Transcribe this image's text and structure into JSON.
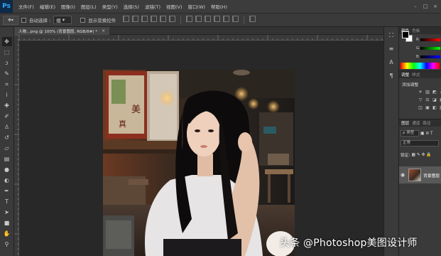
{
  "app": {
    "logo": "Ps"
  },
  "menu": [
    "文件(F)",
    "编辑(E)",
    "图像(I)",
    "图层(L)",
    "类型(Y)",
    "选择(S)",
    "滤镜(T)",
    "视图(V)",
    "窗口(W)",
    "帮助(H)"
  ],
  "options": {
    "auto_select_label": "自动选择 :",
    "auto_select_value": "组",
    "show_transform_label": "显示变换控件"
  },
  "document": {
    "tab_title": "人物...png @ 100% (背景图层, RGB/8#) *",
    "close_glyph": "×"
  },
  "tools": [
    {
      "name": "move-tool-icon",
      "glyph": "✥"
    },
    {
      "name": "marquee-tool-icon",
      "glyph": "⬚"
    },
    {
      "name": "lasso-tool-icon",
      "glyph": "ↄ"
    },
    {
      "name": "quick-select-tool-icon",
      "glyph": "✎"
    },
    {
      "name": "crop-tool-icon",
      "glyph": "⌗"
    },
    {
      "name": "eyedropper-tool-icon",
      "glyph": "ⅰ"
    },
    {
      "name": "healing-brush-icon",
      "glyph": "✚"
    },
    {
      "name": "brush-tool-icon",
      "glyph": "✐"
    },
    {
      "name": "clone-stamp-icon",
      "glyph": "♙"
    },
    {
      "name": "history-brush-icon",
      "glyph": "↺"
    },
    {
      "name": "eraser-tool-icon",
      "glyph": "▱"
    },
    {
      "name": "gradient-tool-icon",
      "glyph": "▤"
    },
    {
      "name": "blur-tool-icon",
      "glyph": "●"
    },
    {
      "name": "dodge-tool-icon",
      "glyph": "◐"
    },
    {
      "name": "pen-tool-icon",
      "glyph": "✒"
    },
    {
      "name": "type-tool-icon",
      "glyph": "T"
    },
    {
      "name": "path-select-icon",
      "glyph": "➤"
    },
    {
      "name": "shape-tool-icon",
      "glyph": "■"
    },
    {
      "name": "hand-tool-icon",
      "glyph": "✋"
    },
    {
      "name": "zoom-tool-icon",
      "glyph": "⚲"
    }
  ],
  "strip": [
    "⛶",
    "≡",
    "A",
    "¶"
  ],
  "panels": {
    "color_tabs": [
      "颜色",
      "色板"
    ],
    "channels": [
      "R",
      "G",
      "B"
    ],
    "adjust_tabs": [
      "调整",
      "样式"
    ],
    "adjust_title": "添加调整",
    "adjust_icons": [
      "☀",
      "▥",
      "◩",
      "▱",
      "▽",
      "⚖",
      "◪",
      "▦",
      "◫",
      "▣",
      "◧",
      "▨"
    ],
    "layer_tabs": [
      "图层",
      "通道",
      "路径"
    ],
    "kind_label": "ρ 类型",
    "blend_mode": "正常",
    "lock_label": "锁定:",
    "layer_name": "背景图层"
  },
  "watermark": "头条 @Photoshop美图设计师",
  "colors": {
    "ui_bg": "#282828",
    "panel": "#3a3a3a",
    "menubar": "#3c3c3c",
    "ps_blue": "#31a8ff"
  }
}
